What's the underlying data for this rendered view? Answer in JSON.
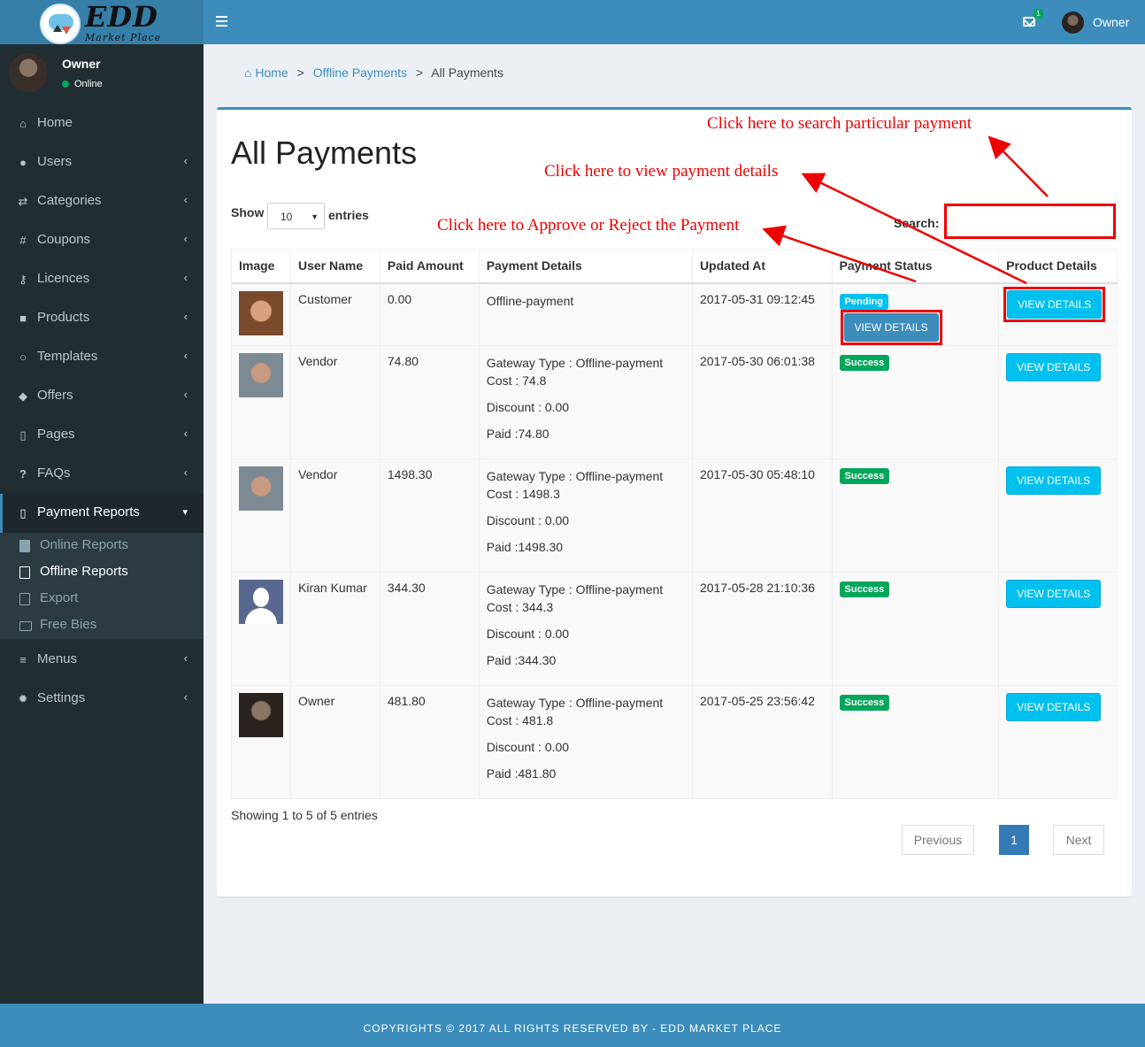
{
  "brand": {
    "title": "EDD",
    "subtitle": "Market Place"
  },
  "header": {
    "mail_count": "1",
    "user": "Owner"
  },
  "sidebar": {
    "user": {
      "name": "Owner",
      "status": "Online"
    },
    "items": [
      {
        "label": "Home",
        "icon": "home-icon"
      },
      {
        "label": "Users",
        "icon": "users-icon"
      },
      {
        "label": "Categories",
        "icon": "shuffle-icon"
      },
      {
        "label": "Coupons",
        "icon": "hashtag-icon"
      },
      {
        "label": "Licences",
        "icon": "key-icon"
      },
      {
        "label": "Products",
        "icon": "briefcase-icon"
      },
      {
        "label": "Templates",
        "icon": "comment-icon"
      },
      {
        "label": "Offers",
        "icon": "tags-icon"
      },
      {
        "label": "Pages",
        "icon": "file-icon"
      },
      {
        "label": "FAQs",
        "icon": "question-icon"
      },
      {
        "label": "Payment Reports",
        "icon": "file-icon"
      },
      {
        "label": "Menus",
        "icon": "bars-icon"
      },
      {
        "label": "Settings",
        "icon": "gear-icon"
      }
    ],
    "sub_items": [
      {
        "label": "Online Reports"
      },
      {
        "label": "Offline Reports"
      },
      {
        "label": "Export"
      },
      {
        "label": "Free Bies"
      }
    ]
  },
  "breadcrumb": {
    "home": "Home",
    "parent": "Offline Payments",
    "current": "All Payments"
  },
  "page_title": "All Payments",
  "controls": {
    "show": "Show",
    "entries_value": "10",
    "entries": "entries",
    "search": "Search:"
  },
  "table": {
    "headers": [
      "Image",
      "User Name",
      "Paid Amount",
      "Payment Details",
      "Updated At",
      "Payment Status",
      "Product Details"
    ],
    "rows": [
      {
        "user": "Customer",
        "amount": "0.00",
        "details": [
          "Offline-payment"
        ],
        "updated": "2017-05-31 09:12:45",
        "status": "Pending",
        "button": "VIEW DETAILS"
      },
      {
        "user": "Vendor",
        "amount": "74.80",
        "details": [
          "Gateway Type : Offline-payment",
          "Cost : 74.8",
          "Discount : 0.00",
          "Paid :74.80"
        ],
        "updated": "2017-05-30 06:01:38",
        "status": "Success",
        "button": "VIEW DETAILS"
      },
      {
        "user": "Vendor",
        "amount": "1498.30",
        "details": [
          "Gateway Type : Offline-payment",
          "Cost : 1498.3",
          "Discount : 0.00",
          "Paid :1498.30"
        ],
        "updated": "2017-05-30 05:48:10",
        "status": "Success",
        "button": "VIEW DETAILS"
      },
      {
        "user": "Kiran Kumar",
        "amount": "344.30",
        "details": [
          "Gateway Type : Offline-payment",
          "Cost : 344.3",
          "Discount : 0.00",
          "Paid :344.30"
        ],
        "updated": "2017-05-28 21:10:36",
        "status": "Success",
        "button": "VIEW DETAILS"
      },
      {
        "user": "Owner",
        "amount": "481.80",
        "details": [
          "Gateway Type : Offline-payment",
          "Cost : 481.8",
          "Discount : 0.00",
          "Paid :481.80"
        ],
        "updated": "2017-05-25 23:56:42",
        "status": "Success",
        "button": "VIEW DETAILS"
      }
    ],
    "pending_button": "VIEW DETAILS"
  },
  "footer_info": {
    "showing": "Showing 1 to 5 of 5 entries",
    "previous": "Previous",
    "page": "1",
    "next": "Next"
  },
  "annotations": {
    "search": "Click here to search particular payment",
    "view": "Click here to view payment details",
    "approve": "Click here to Approve or Reject the Payment"
  },
  "footer": "COPYRIGHTS © 2017 ALL RIGHTS RESERVED BY - EDD MARKET PLACE",
  "colors": {
    "primary": "#3c8dbc",
    "sidebar": "#222d32",
    "annotation": "#ee0000",
    "success": "#00a65a",
    "info": "#00c0ef"
  }
}
